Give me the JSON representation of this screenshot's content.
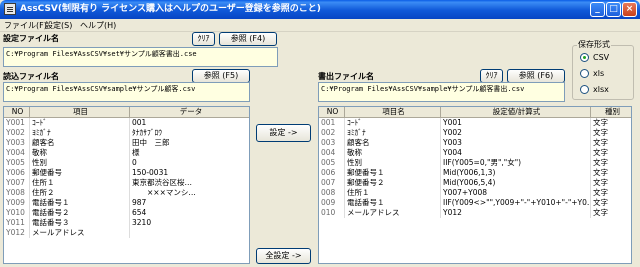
{
  "window": {
    "title": "AssCSV(制限有り ライセンス購入はヘルプのユーザー登録を参照のこと)"
  },
  "titlebar_buttons": {
    "minimize": "_",
    "maximize": "□",
    "close": "×"
  },
  "menu": [
    "ファイル(F)",
    "設定(S)",
    "ヘルプ(H)"
  ],
  "settings_file": {
    "label": "設定ファイル名",
    "clear_button": "ｸﾘｱ",
    "browse_button": "参照 (F4)",
    "path": "C:¥Program Files¥AssCSV¥set¥サンプル顧客書出.cse"
  },
  "read_file": {
    "label": "読込ファイル名",
    "browse_button": "参照 (F5)",
    "path": "C:¥Program Files¥AssCSV¥sample¥サンプル顧客.csv"
  },
  "write_file": {
    "label": "書出ファイル名",
    "clear_button": "ｸﾘｱ",
    "browse_button": "参照 (F6)",
    "path": "C:¥Program Files¥AssCSV¥sample¥サンプル顧客書出.csv"
  },
  "save_format": {
    "label": "保存形式",
    "options": [
      "CSV",
      "xls",
      "xlsx"
    ],
    "selected": "CSV"
  },
  "actions": {
    "set_button": "設定 ->",
    "set_all_button": "全設定 ->"
  },
  "left_table": {
    "headers": [
      "NO",
      "項目",
      "データ"
    ],
    "rows": [
      [
        "Y001",
        "ｺｰﾄﾞ",
        "001"
      ],
      [
        "Y002",
        "ﾖﾐｶﾞﾅ",
        "ﾀﾅｶｻﾌﾞﾛｳ"
      ],
      [
        "Y003",
        "顧客名",
        "田中　三郎"
      ],
      [
        "Y004",
        "敬称",
        "様"
      ],
      [
        "Y005",
        "性別",
        "0"
      ],
      [
        "Y006",
        "郵便番号",
        "150-0031"
      ],
      [
        "Y007",
        "住所１",
        "東京都渋谷区桜…"
      ],
      [
        "Y008",
        "住所２",
        "　　×××マンシ…"
      ],
      [
        "Y009",
        "電話番号１",
        "987"
      ],
      [
        "Y010",
        "電話番号２",
        "654"
      ],
      [
        "Y011",
        "電話番号３",
        "3210"
      ],
      [
        "Y012",
        "メールアドレス",
        ""
      ]
    ]
  },
  "right_table": {
    "headers": [
      "NO",
      "項目名",
      "設定値/計算式",
      "種別"
    ],
    "rows": [
      [
        "001",
        "ｺｰﾄﾞ",
        "Y001",
        "文字"
      ],
      [
        "002",
        "ﾖﾐｶﾞﾅ",
        "Y002",
        "文字"
      ],
      [
        "003",
        "顧客名",
        "Y003",
        "文字"
      ],
      [
        "004",
        "敬称",
        "Y004",
        "文字"
      ],
      [
        "005",
        "性別",
        "IIF(Y005=0,\"男\",\"女\")",
        "文字"
      ],
      [
        "006",
        "郵便番号１",
        "Mid(Y006,1,3)",
        "文字"
      ],
      [
        "007",
        "郵便番号２",
        "Mid(Y006,5,4)",
        "文字"
      ],
      [
        "008",
        "住所１",
        "Y007+Y008",
        "文字"
      ],
      [
        "009",
        "電話番号１",
        "IIF(Y009<>\"\",Y009+\"-\"+Y010+\"-\"+Y0…",
        "文字"
      ],
      [
        "010",
        "メールアドレス",
        "Y012",
        "文字"
      ]
    ]
  }
}
